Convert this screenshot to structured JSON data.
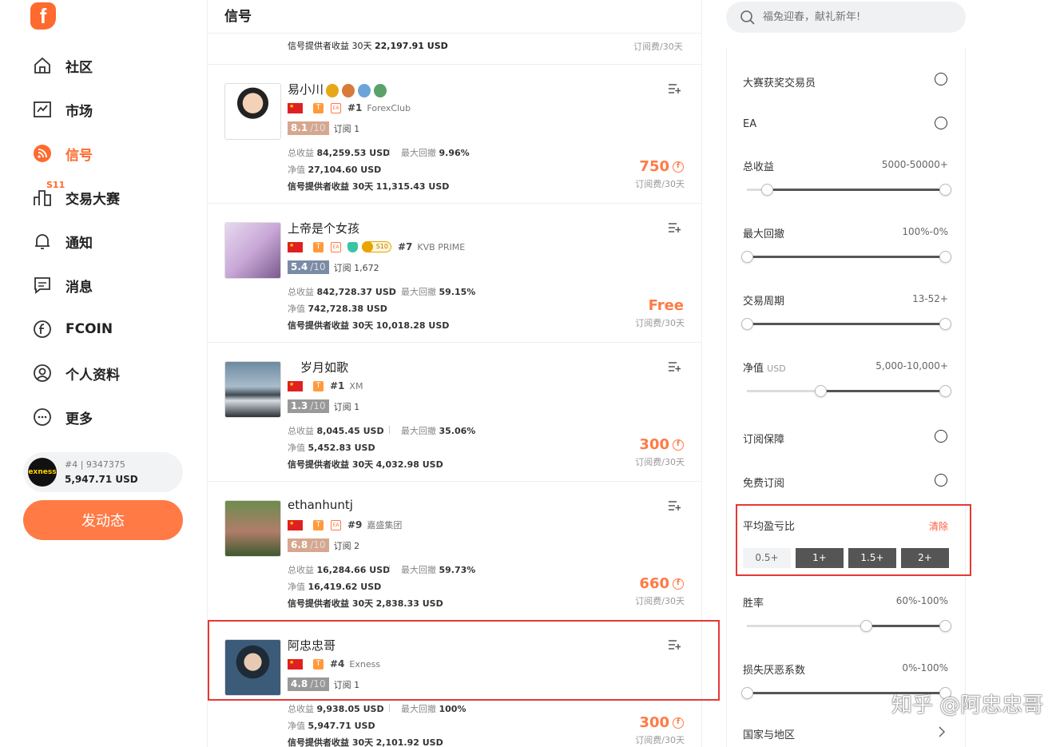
{
  "brand": {
    "logo_letter": "f"
  },
  "nav": [
    {
      "label": "社区",
      "icon": "home-icon"
    },
    {
      "label": "市场",
      "icon": "market-chart-icon"
    },
    {
      "label": "信号",
      "icon": "rss-signal-icon",
      "active": true
    },
    {
      "label": "交易大赛",
      "icon": "competition-bars-icon",
      "badge": "S11"
    },
    {
      "label": "通知",
      "icon": "bell-icon"
    },
    {
      "label": "消息",
      "icon": "message-icon"
    },
    {
      "label": "FCOIN",
      "icon": "fcoin-icon"
    },
    {
      "label": "个人资料",
      "icon": "profile-icon"
    },
    {
      "label": "更多",
      "icon": "more-icon"
    }
  ],
  "account": {
    "avatar_text": "exness",
    "rank_id": "#4 | 9347375",
    "balance": "5,947.71 USD"
  },
  "post_button": "发动态",
  "page_title": "信号",
  "top_strip": {
    "provider_label": "信号提供者收益 30天",
    "provider_value": "22,197.91 USD",
    "fee": "订阅费/30天"
  },
  "signals": [
    {
      "name": "易小川",
      "medals": 4,
      "rank": "#1",
      "broker": "ForexClub",
      "score": "8.1",
      "score_den": "/10",
      "subs_label": "订阅",
      "subs": "1",
      "total_label": "总收益",
      "total": "84,259.53 USD",
      "dd_label": "最大回撤",
      "dd": "9.96%",
      "equity_label": "净值",
      "equity": "27,104.60 USD",
      "provider_label": "信号提供者收益 30天",
      "provider": "11,315.43 USD",
      "price": "750",
      "fee": "订阅费/30天"
    },
    {
      "name": "上帝是个女孩",
      "rank": "#7",
      "broker": "KVB PRIME",
      "badge": "S10",
      "score": "5.4",
      "score_den": "/10",
      "subs_label": "订阅",
      "subs": "1,672",
      "total_label": "总收益",
      "total": "842,728.37 USD",
      "dd_label": "最大回撤",
      "dd": "59.15%",
      "equity_label": "净值",
      "equity": "742,728.38 USD",
      "provider_label": "信号提供者收益 30天",
      "provider": "10,018.28 USD",
      "price": "Free",
      "fee": "订阅费/30天"
    },
    {
      "name": "岁月如歌",
      "rank": "#1",
      "broker": "XM",
      "score": "1.3",
      "score_den": "/10",
      "subs_label": "订阅",
      "subs": "1",
      "total_label": "总收益",
      "total": "8,045.45 USD",
      "dd_label": "最大回撤",
      "dd": "35.06%",
      "equity_label": "净值",
      "equity": "5,452.83 USD",
      "provider_label": "信号提供者收益 30天",
      "provider": "4,032.98 USD",
      "price": "300",
      "fee": "订阅费/30天"
    },
    {
      "name": "ethanhuntj",
      "rank": "#9",
      "broker": "嘉盛集团",
      "score": "6.8",
      "score_den": "/10",
      "subs_label": "订阅",
      "subs": "2",
      "total_label": "总收益",
      "total": "16,284.66 USD",
      "dd_label": "最大回撤",
      "dd": "59.73%",
      "equity_label": "净值",
      "equity": "16,419.62 USD",
      "provider_label": "信号提供者收益 30天",
      "provider": "2,838.33 USD",
      "price": "660",
      "fee": "订阅费/30天"
    },
    {
      "name": "阿忠忠哥",
      "rank": "#4",
      "broker": "Exness",
      "score": "4.8",
      "score_den": "/10",
      "subs_label": "订阅",
      "subs": "1",
      "total_label": "总收益",
      "total": "9,938.05 USD",
      "dd_label": "最大回撤",
      "dd": "100%",
      "equity_label": "净值",
      "equity": "5,947.71 USD",
      "provider_label": "信号提供者收益 30天",
      "provider": "2,101.92 USD",
      "price": "300",
      "fee": "订阅费/30天"
    }
  ],
  "search": {
    "placeholder": "福兔迎春，献礼新年!"
  },
  "filters": {
    "award": "大赛获奖交易员",
    "ea": "EA",
    "total_return": {
      "label": "总收益",
      "value": "5000-50000+",
      "low": 0.1,
      "high": 1.0
    },
    "max_dd": {
      "label": "最大回撤",
      "value": "100%-0%",
      "low": 0.0,
      "high": 1.0
    },
    "period": {
      "label": "交易周期",
      "value": "13-52+",
      "low": 0.0,
      "high": 1.0
    },
    "equity": {
      "label": "净值",
      "unit": "USD",
      "value": "5,000-10,000+",
      "low": 0.37,
      "high": 1.0
    },
    "guarantee": "订阅保障",
    "free": "免费订阅",
    "avg_pl": {
      "label": "平均盈亏比",
      "clear": "清除",
      "options": [
        "0.5+",
        "1+",
        "1.5+",
        "2+"
      ],
      "selected": [
        1,
        2,
        3
      ]
    },
    "winrate": {
      "label": "胜率",
      "value": "60%-100%",
      "low": 0.6,
      "high": 1.0
    },
    "loss_aversion": {
      "label": "损失厌恶系数",
      "value": "0%-100%",
      "low": 0.0,
      "high": 1.0
    },
    "region": "国家与地区"
  },
  "watermark": "知乎 @阿忠忠哥",
  "colors": {
    "accent": "#ff6a2e",
    "highlight": "#e53935"
  }
}
